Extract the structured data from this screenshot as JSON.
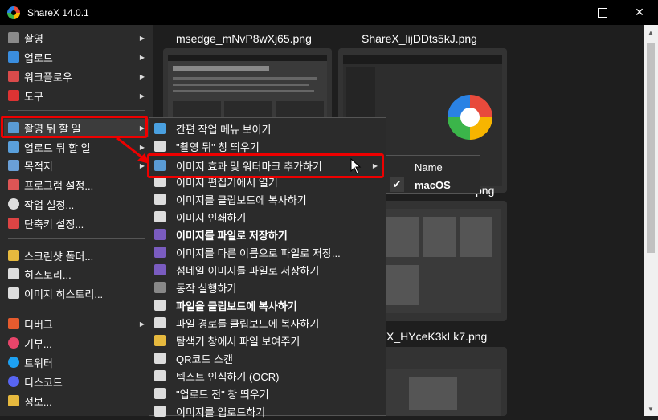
{
  "window": {
    "title": "ShareX 14.0.1",
    "minimize": "—",
    "maximize_icon": "maximize-icon",
    "close": "✕"
  },
  "main_menu": {
    "items": [
      {
        "label": "촬영",
        "icon": "camera-icon",
        "color": "#8a8a8a",
        "arrow": "▶"
      },
      {
        "label": "업로드",
        "icon": "upload-arrow-icon",
        "color": "#3a8dde",
        "arrow": "▶"
      },
      {
        "label": "워크플로우",
        "icon": "workflow-grid-icon",
        "color": "#d94b4b",
        "arrow": "▶"
      },
      {
        "label": "도구",
        "icon": "toolbox-icon",
        "color": "#d33",
        "arrow": "▶"
      },
      {
        "label": "촬영 뒤 할 일",
        "icon": "after-capture-icon",
        "color": "#5a9bd4",
        "arrow": "▶"
      },
      {
        "label": "업로드 뒤 할 일",
        "icon": "after-upload-icon",
        "color": "#5aa0dc",
        "arrow": "▶"
      },
      {
        "label": "목적지",
        "icon": "destination-icon",
        "color": "#6a9fd6",
        "arrow": "▶"
      },
      {
        "label": "프로그램 설정...",
        "icon": "wrench-icon",
        "color": "#d55"
      },
      {
        "label": "작업 설정...",
        "icon": "gear-icon",
        "color": "#ddd"
      },
      {
        "label": "단축키 설정...",
        "icon": "keyboard-icon",
        "color": "#d44"
      },
      {
        "label": "스크린샷 폴더...",
        "icon": "folder-icon",
        "color": "#e6b93e"
      },
      {
        "label": "히스토리...",
        "icon": "history-icon",
        "color": "#ddd"
      },
      {
        "label": "이미지 히스토리...",
        "icon": "image-history-icon",
        "color": "#ddd"
      },
      {
        "label": "디버그",
        "icon": "debug-cone-icon",
        "color": "#e65b2e",
        "arrow": "▶"
      },
      {
        "label": "기부...",
        "icon": "heart-icon",
        "color": "#e8456a"
      },
      {
        "label": "트위터",
        "icon": "twitter-icon",
        "color": "#1da1f2"
      },
      {
        "label": "디스코드",
        "icon": "discord-icon",
        "color": "#5865f2"
      },
      {
        "label": "정보...",
        "icon": "crown-icon",
        "color": "#e6b93e"
      }
    ]
  },
  "gallery": {
    "items": [
      {
        "title": "msedge_mNvP8wXj65.png"
      },
      {
        "title": "ShareX_lijDDts5kJ.png"
      },
      {
        "title": "png"
      },
      {
        "title": "X_HYceK3kLk7.png"
      }
    ]
  },
  "submenu": {
    "items": [
      {
        "label": "간편 작업 메뉴 보이기",
        "icon": "quick-menu-icon",
        "color": "#4aa0e0"
      },
      {
        "label": "\"촬영 뒤\" 창 띄우기",
        "icon": "after-capture-window-icon",
        "color": "#ddd"
      },
      {
        "label": "이미지 효과 및 워터마크 추가하기",
        "icon": "image-effects-icon",
        "color": "#5a9bd4",
        "arrow": "▶"
      },
      {
        "label": "이미지 편집기에서 열기",
        "icon": "image-editor-icon",
        "color": "#ddd"
      },
      {
        "label": "이미지를 클립보드에 복사하기",
        "icon": "copy-image-icon",
        "color": "#ddd"
      },
      {
        "label": "이미지 인쇄하기",
        "icon": "printer-icon",
        "color": "#ddd"
      },
      {
        "label": "이미지를 파일로 저장하기",
        "icon": "save-icon",
        "color": "#7a5cc0",
        "bold": true
      },
      {
        "label": "이미지를 다른 이름으로 파일로 저장...",
        "icon": "save-as-icon",
        "color": "#7a5cc0"
      },
      {
        "label": "섬네일 이미지를 파일로 저장하기",
        "icon": "thumbnail-save-icon",
        "color": "#7a5cc0"
      },
      {
        "label": "동작 실행하기",
        "icon": "terminal-icon",
        "color": "#888"
      },
      {
        "label": "파일을 클립보드에 복사하기",
        "icon": "copy-file-icon",
        "color": "#ddd",
        "bold": true
      },
      {
        "label": "파일 경로를 클립보드에 복사하기",
        "icon": "clipboard-icon",
        "color": "#ddd"
      },
      {
        "label": "탐색기 창에서 파일 보여주기",
        "icon": "explorer-folder-icon",
        "color": "#e6b93e"
      },
      {
        "label": "QR코드 스캔",
        "icon": "qr-code-icon",
        "color": "#ddd"
      },
      {
        "label": "텍스트 인식하기 (OCR)",
        "icon": "ocr-text-icon",
        "color": "#ddd"
      },
      {
        "label": "\"업로드 전\" 창 띄우기",
        "icon": "before-upload-window-icon",
        "color": "#ddd"
      },
      {
        "label": "이미지를 업로드하기",
        "icon": "cloud-upload-icon",
        "color": "#ddd"
      }
    ]
  },
  "submenu2": {
    "items": [
      {
        "label": "Name",
        "checked": false
      },
      {
        "label": "macOS",
        "checked": true,
        "check": "✔"
      }
    ]
  },
  "colors": {
    "highlight_box": "#e00000",
    "menu_bg": "#2b2b2b",
    "window_bg": "#1e1e1e"
  }
}
